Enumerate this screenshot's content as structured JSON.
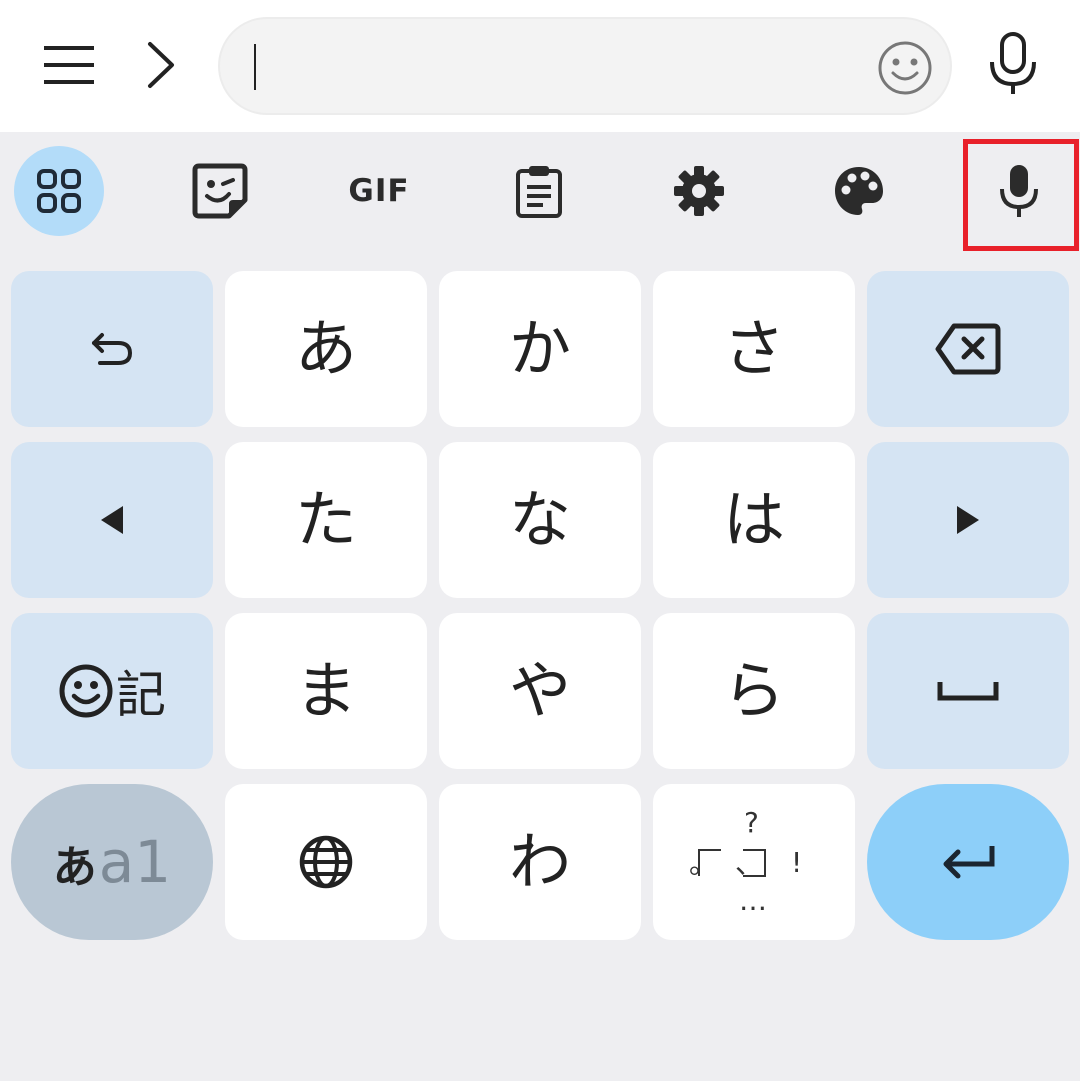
{
  "app_bar": {
    "search": {
      "value": ""
    },
    "icons": [
      "menu-icon",
      "chevron-right-icon",
      "smiley-icon",
      "microphone-icon"
    ]
  },
  "toolbar": {
    "gif_label": "GIF",
    "icons": [
      "apps-grid-icon",
      "sticker-icon",
      "gif-icon",
      "clipboard-icon",
      "settings-icon",
      "palette-icon",
      "microphone-icon"
    ],
    "highlighted": "voice-input"
  },
  "keyboard": {
    "kana": {
      "a": "あ",
      "ka": "か",
      "sa": "さ",
      "ta": "た",
      "na": "な",
      "ha": "は",
      "ma": "ま",
      "ya": "や",
      "ra": "ら",
      "wa": "わ"
    },
    "symbol_key_label": "記",
    "mode_key": {
      "kana": "あ",
      "latin": "a1"
    },
    "punct_key": {
      "question": "?",
      "maru": "。",
      "ten": "、",
      "exclaim": "!",
      "ellipsis": "…"
    }
  },
  "colors": {
    "highlight": "#e8202a",
    "function_key": "#d5e4f3",
    "enter_key": "#8dcff9",
    "apps_button": "#b3dcf9"
  }
}
